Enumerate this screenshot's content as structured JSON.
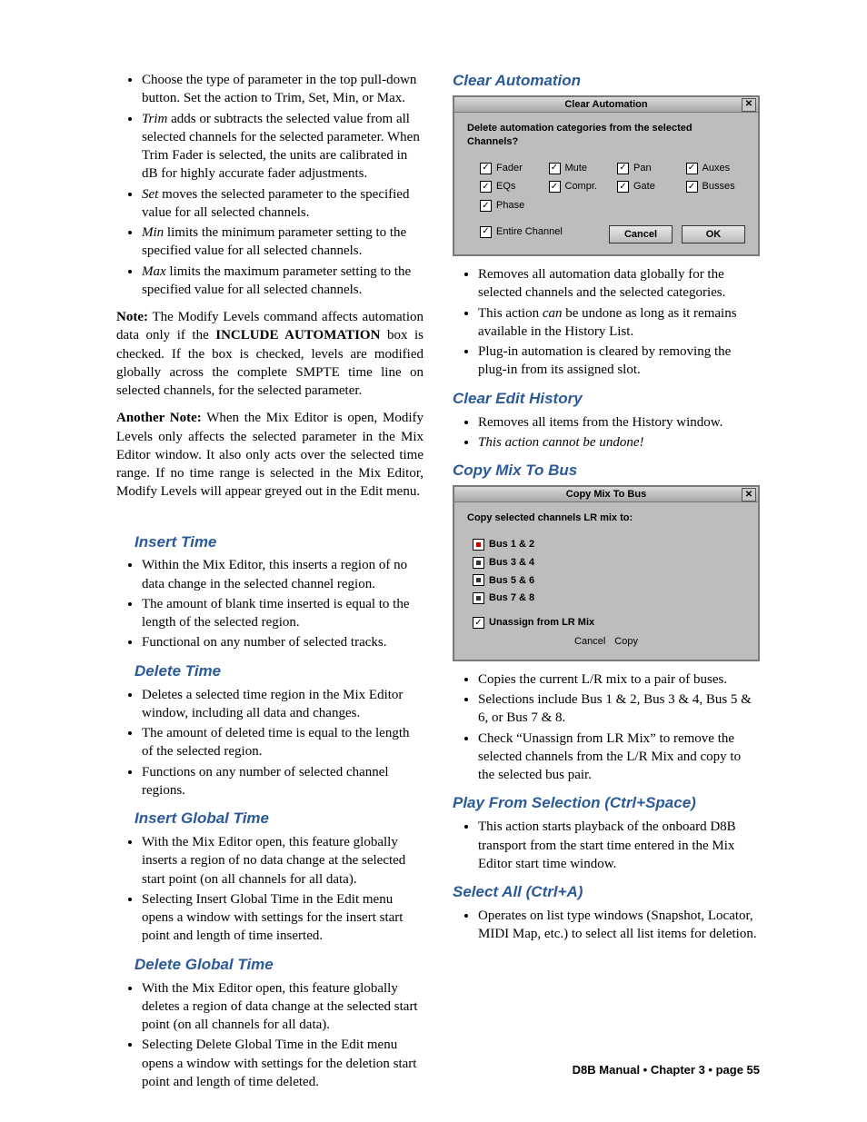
{
  "left": {
    "intro_bullets": [
      {
        "text": "Choose the type of parameter in the top pull-down button. Set the action to Trim, Set, Min, or Max."
      },
      {
        "em": "Trim",
        "text": " adds or subtracts the selected value from all selected channels for the selected parameter. When Trim Fader is selected, the units are calibrated in dB for highly accurate fader adjustments."
      },
      {
        "em": "Set",
        "text": " moves the selected parameter to the specified value for all selected channels."
      },
      {
        "em": "Min",
        "text": " limits the minimum parameter setting to the specified value for all selected channels."
      },
      {
        "em": "Max",
        "text": " limits the maximum parameter setting to the specified value for all selected channels."
      }
    ],
    "note1_label": "Note:",
    "note1": " The Modify Levels command affects automation data only if the ",
    "note1_b": "INCLUDE AUTOMATION",
    "note1_tail": " box is checked. If the box is checked, levels are modified globally across the complete SMPTE time line on selected channels, for the selected parameter.",
    "note2_label": "Another Note:",
    "note2": " When the Mix Editor is open, Modify Levels only affects the selected parameter in the Mix Editor window. It also only acts over the selected time range. If no time range is selected in the Mix Editor, Modify Levels will appear greyed out in the Edit menu.",
    "sections": [
      {
        "title": "Insert Time",
        "items": [
          "Within the Mix Editor, this inserts a region of no data change in the selected channel region.",
          "The amount of blank time inserted is equal to the length of the selected region.",
          "Functional on any number of selected tracks."
        ]
      },
      {
        "title": "Delete Time",
        "items": [
          "Deletes a selected time region in the Mix Editor window, including all data and changes.",
          "The amount of deleted time is equal to the length of the selected region.",
          "Functions on any number of selected channel regions."
        ]
      },
      {
        "title": "Insert Global Time",
        "items": [
          "With the Mix Editor open, this feature globally inserts a region of no data change at the selected start point (on all channels for all data).",
          "Selecting Insert Global Time in the Edit menu opens a window with settings for the insert start point and length of time inserted."
        ]
      },
      {
        "title": "Delete Global Time",
        "items": [
          "With the Mix Editor open, this feature globally deletes a region of data change at the selected start point (on all channels for all data).",
          "Selecting Delete Global Time in the Edit menu opens a window with settings for the deletion start point and length of time deleted."
        ]
      }
    ]
  },
  "right": {
    "clear_auto": {
      "title": "Clear Automation",
      "dlg_title": "Clear Automation",
      "prompt": "Delete automation categories from the selected Channels?",
      "checks": [
        "Fader",
        "Mute",
        "Pan",
        "Auxes",
        "EQs",
        "Compr.",
        "Gate",
        "Busses",
        "Phase"
      ],
      "entire": "Entire Channel",
      "cancel": "Cancel",
      "ok": "OK",
      "bullets": [
        {
          "text": "Removes all automation data globally for the selected channels and the selected categories."
        },
        {
          "pre": "This action ",
          "em": "can",
          "post": " be undone as long as it remains available in the History List."
        },
        {
          "text": "Plug-in automation is cleared by removing the plug-in from its assigned slot."
        }
      ]
    },
    "clear_hist": {
      "title": "Clear Edit History",
      "bullets": [
        {
          "text": "Removes all items from the History window."
        },
        {
          "em_full": "This action cannot be undone!"
        }
      ]
    },
    "copy_mix": {
      "title": "Copy Mix To Bus",
      "dlg_title": "Copy Mix To Bus",
      "prompt": "Copy selected channels LR mix to:",
      "options": [
        "Bus 1 & 2",
        "Bus 3 & 4",
        "Bus 5 & 6",
        "Bus 7 & 8"
      ],
      "unassign": "Unassign from LR Mix",
      "cancel": "Cancel",
      "copy": "Copy",
      "bullets": [
        "Copies the current L/R mix to a pair of buses.",
        "Selections include Bus 1 & 2, Bus 3 & 4, Bus 5 & 6, or Bus 7 & 8.",
        "Check “Unassign from LR Mix” to remove the selected channels from the L/R Mix and copy to the selected bus pair."
      ]
    },
    "play_sel": {
      "title": "Play From Selection (Ctrl+Space)",
      "bullets": [
        "This action starts playback of the onboard D8B transport from the start time entered in the Mix Editor start time window."
      ]
    },
    "select_all": {
      "title": "Select All (Ctrl+A)",
      "bullets": [
        "Operates on list type windows (Snapshot, Locator, MIDI Map, etc.) to select all list items for deletion."
      ]
    }
  },
  "footer": "D8B Manual • Chapter 3 • page  55"
}
